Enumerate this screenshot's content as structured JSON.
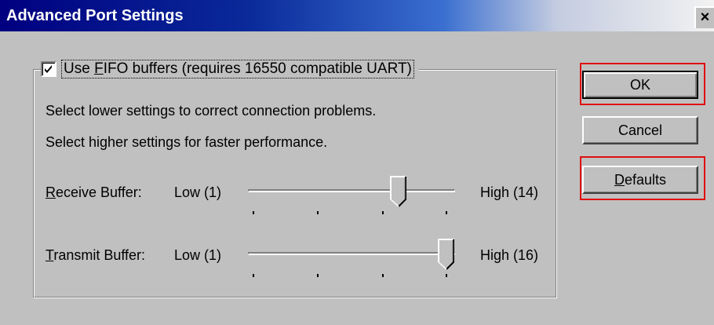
{
  "window": {
    "title": "Advanced Port Settings",
    "close_glyph": "×"
  },
  "fifo": {
    "checked": true,
    "label_pre": "Use ",
    "label_mnemonic": "F",
    "label_post": "IFO buffers (requires 16550 compatible UART)"
  },
  "description": {
    "line1": "Select lower settings to correct connection problems.",
    "line2": "Select higher settings for faster performance."
  },
  "receive": {
    "label_mnemonic": "R",
    "label_rest": "eceive Buffer:",
    "low": "Low (1)",
    "high": "High (14)",
    "level": 3,
    "max_level": 4
  },
  "transmit": {
    "label_mnemonic": "T",
    "label_rest": "ransmit Buffer:",
    "low": "Low (1)",
    "high": "High (16)",
    "level": 4,
    "max_level": 4
  },
  "buttons": {
    "ok": "OK",
    "cancel": "Cancel",
    "defaults_mnemonic": "D",
    "defaults_rest": "efaults"
  },
  "colors": {
    "title_active": "#000080",
    "highlight": "#e01010",
    "dialog_face": "#c0c0c0"
  }
}
